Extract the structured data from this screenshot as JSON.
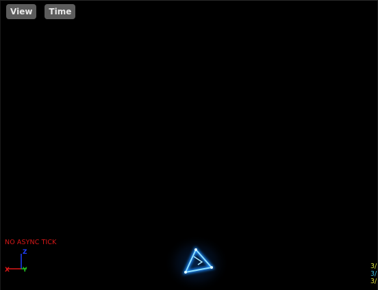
{
  "toolbar": {
    "view_label": "View",
    "time_label": "Time"
  },
  "viewport": {
    "warning_text": "NO ASYNC TICK",
    "axis_labels": {
      "x": "X",
      "y": "Y",
      "z": "Z"
    },
    "stats": [
      {
        "text": "3/",
        "color": "#d4e040"
      },
      {
        "text": "3/",
        "color": "#40c0e0"
      },
      {
        "text": "3/",
        "color": "#e0e040"
      }
    ]
  },
  "colors": {
    "background": "#000000",
    "button_bg": "#5c5c5c",
    "warning": "#d81818",
    "axis_x": "#e01818",
    "axis_y": "#20c020",
    "axis_z": "#2040ff",
    "emitter_glow": "#1a8cff"
  }
}
